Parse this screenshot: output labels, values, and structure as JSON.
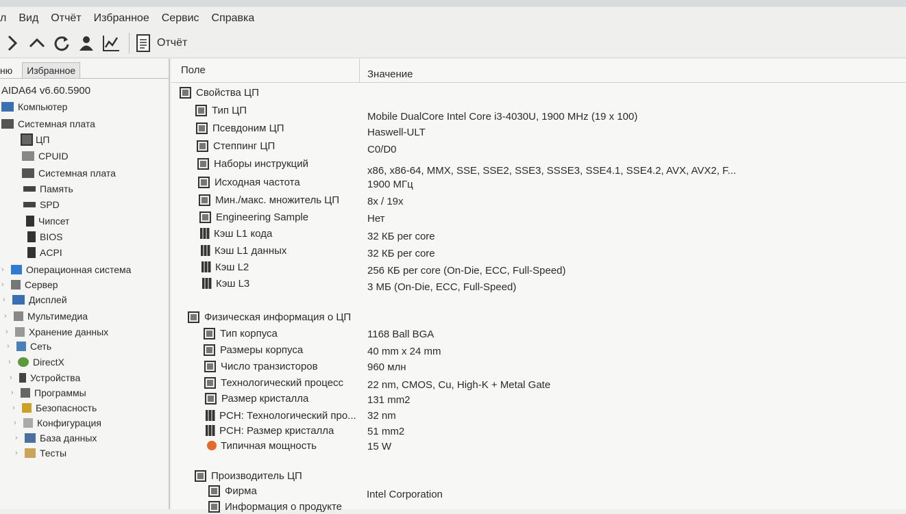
{
  "menu": [
    "л",
    "Вид",
    "Отчёт",
    "Избранное",
    "Сервис",
    "Справка"
  ],
  "toolbar": {
    "report_label": "Отчёт"
  },
  "sidebar": {
    "tabs": [
      "ню",
      "Избранное"
    ],
    "root": "AIDA64 v6.60.5900",
    "items": [
      {
        "label": "Компьютер",
        "icon": "computer-icon"
      },
      {
        "label": "Системная плата",
        "icon": "motherboard-icon"
      },
      {
        "label": "ЦП",
        "icon": "cpu-icon"
      },
      {
        "label": "CPUID",
        "icon": "cpuid-icon"
      },
      {
        "label": "Системная плата",
        "icon": "motherboard-icon"
      },
      {
        "label": "Память",
        "icon": "memory-icon"
      },
      {
        "label": "SPD",
        "icon": "spd-icon"
      },
      {
        "label": "Чипсет",
        "icon": "chipset-icon"
      },
      {
        "label": "BIOS",
        "icon": "bios-icon"
      },
      {
        "label": "ACPI",
        "icon": "acpi-icon"
      },
      {
        "label": "Операционная система",
        "icon": "os-icon"
      },
      {
        "label": "Сервер",
        "icon": "server-icon"
      },
      {
        "label": "Дисплей",
        "icon": "display-icon"
      },
      {
        "label": "Мультимедиа",
        "icon": "multimedia-icon"
      },
      {
        "label": "Хранение данных",
        "icon": "storage-icon"
      },
      {
        "label": "Сеть",
        "icon": "network-icon"
      },
      {
        "label": "DirectX",
        "icon": "directx-icon"
      },
      {
        "label": "Устройства",
        "icon": "devices-icon"
      },
      {
        "label": "Программы",
        "icon": "programs-icon"
      },
      {
        "label": "Безопасность",
        "icon": "security-icon"
      },
      {
        "label": "Конфигурация",
        "icon": "config-icon"
      },
      {
        "label": "База данных",
        "icon": "database-icon"
      },
      {
        "label": "Тесты",
        "icon": "tests-icon"
      }
    ]
  },
  "table": {
    "headers": [
      "Поле",
      "Значение"
    ],
    "groups": [
      {
        "title": "Свойства ЦП",
        "rows": [
          {
            "field": "Тип ЦП",
            "value": "Mobile DualCore Intel Core i3-4030U, 1900 MHz (19 x 100)",
            "icon": "box"
          },
          {
            "field": "Псевдоним ЦП",
            "value": "Haswell-ULT",
            "icon": "box"
          },
          {
            "field": "Степпинг ЦП",
            "value": "C0/D0",
            "icon": "box"
          },
          {
            "field": "Наборы инструкций",
            "value": "x86, x86-64, MMX, SSE, SSE2, SSE3, SSSE3, SSE4.1, SSE4.2, AVX, AVX2, F...",
            "icon": "box"
          },
          {
            "field": "Исходная частота",
            "value": "1900 МГц",
            "icon": "box"
          },
          {
            "field": "Мин./макс. множитель ЦП",
            "value": "8x / 19x",
            "icon": "box"
          },
          {
            "field": "Engineering Sample",
            "value": "Нет",
            "icon": "box"
          },
          {
            "field": "Кэш L1 кода",
            "value": "32 КБ per core",
            "icon": "bars"
          },
          {
            "field": "Кэш L1 данных",
            "value": "32 КБ per core",
            "icon": "bars"
          },
          {
            "field": "Кэш L2",
            "value": "256 КБ per core  (On-Die, ECC, Full-Speed)",
            "icon": "bars"
          },
          {
            "field": "Кэш L3",
            "value": "3 МБ  (On-Die, ECC, Full-Speed)",
            "icon": "bars"
          }
        ]
      },
      {
        "title": "Физическая информация о ЦП",
        "rows": [
          {
            "field": "Тип корпуса",
            "value": "1168 Ball BGA",
            "icon": "box"
          },
          {
            "field": "Размеры корпуса",
            "value": "40 mm x 24 mm",
            "icon": "box"
          },
          {
            "field": "Число транзисторов",
            "value": "960 млн",
            "icon": "box"
          },
          {
            "field": "Технологический процесс",
            "value": "22 nm, CMOS, Cu, High-K + Metal Gate",
            "icon": "box"
          },
          {
            "field": "Размер кристалла",
            "value": "131 mm2",
            "icon": "box"
          },
          {
            "field": "PCH: Технологический про...",
            "value": "32 nm",
            "icon": "bars"
          },
          {
            "field": "PCH: Размер кристалла",
            "value": "51 mm2",
            "icon": "bars"
          },
          {
            "field": "Типичная мощность",
            "value": "15 W",
            "icon": "power"
          }
        ]
      },
      {
        "title": "Производитель ЦП",
        "rows": [
          {
            "field": "Фирма",
            "value": "Intel Corporation",
            "icon": "box"
          },
          {
            "field": "Информация о продукте",
            "value": "",
            "icon": "box"
          }
        ]
      }
    ]
  }
}
